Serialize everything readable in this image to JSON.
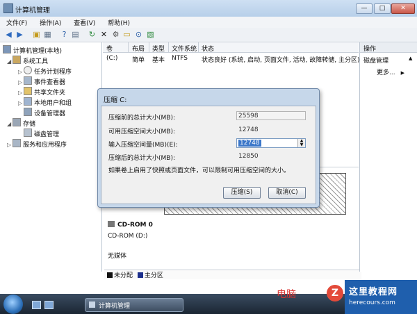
{
  "window": {
    "title": "计算机管理",
    "buttons": [
      "—",
      "□",
      "✕"
    ]
  },
  "menu": [
    "文件(F)",
    "操作(A)",
    "查看(V)",
    "帮助(H)"
  ],
  "toolbar_icons": [
    "back-arrow-icon",
    "forward-arrow-icon",
    "up-folder-icon",
    "show-hide-tree-icon",
    "help-icon",
    "properties-icon",
    "refresh-icon",
    "delete-icon",
    "settings-icon",
    "open-folder-icon",
    "search-icon",
    "export-icon"
  ],
  "tree": {
    "root": "计算机管理(本地)",
    "system_tools": "系统工具",
    "task_scheduler": "任务计划程序",
    "event_viewer": "事件查看器",
    "shared_folders": "共享文件夹",
    "local_users": "本地用户和组",
    "device_manager": "设备管理器",
    "storage": "存储",
    "disk_management": "磁盘管理",
    "services": "服务和应用程序"
  },
  "volume_table": {
    "headers": [
      "卷",
      "布局",
      "类型",
      "文件系统",
      "状态"
    ],
    "row": {
      "volume": "(C:)",
      "layout": "简单",
      "type": "基本",
      "fs": "NTFS",
      "status": "状态良好 (系统, 启动, 页面文件, 活动, 故障转储, 主分区)"
    }
  },
  "actions": {
    "header": "操作",
    "section": "磁盘管理",
    "more": "更多..."
  },
  "cdrom": {
    "name": "CD-ROM 0",
    "drive": "CD-ROM (D:)",
    "media": "无媒体"
  },
  "legend": {
    "unallocated": "未分配",
    "primary": "主分区",
    "unallocated_color": "#111111",
    "primary_color": "#1c2f8c"
  },
  "dialog": {
    "title": "压缩 C:",
    "total_before_label": "压缩前的总计大小(MB):",
    "total_before_value": "25598",
    "available_label": "可用压缩空间大小(MB):",
    "available_value": "12748",
    "input_label": "输入压缩空间量(MB)(E):",
    "input_value": "12748",
    "total_after_label": "压缩后的总计大小(MB):",
    "total_after_value": "12850",
    "note": "如果卷上启用了快照或页面文件，可以限制可用压缩空间的大小。",
    "shrink_button": "压缩(S)",
    "cancel_button": "取消(C)"
  },
  "taskbar": {
    "task_label": "计算机管理"
  },
  "watermark": {
    "text": "电脑",
    "logo_letter": "Z",
    "site_name": "这里教程网",
    "site_url": "herecours.com"
  }
}
